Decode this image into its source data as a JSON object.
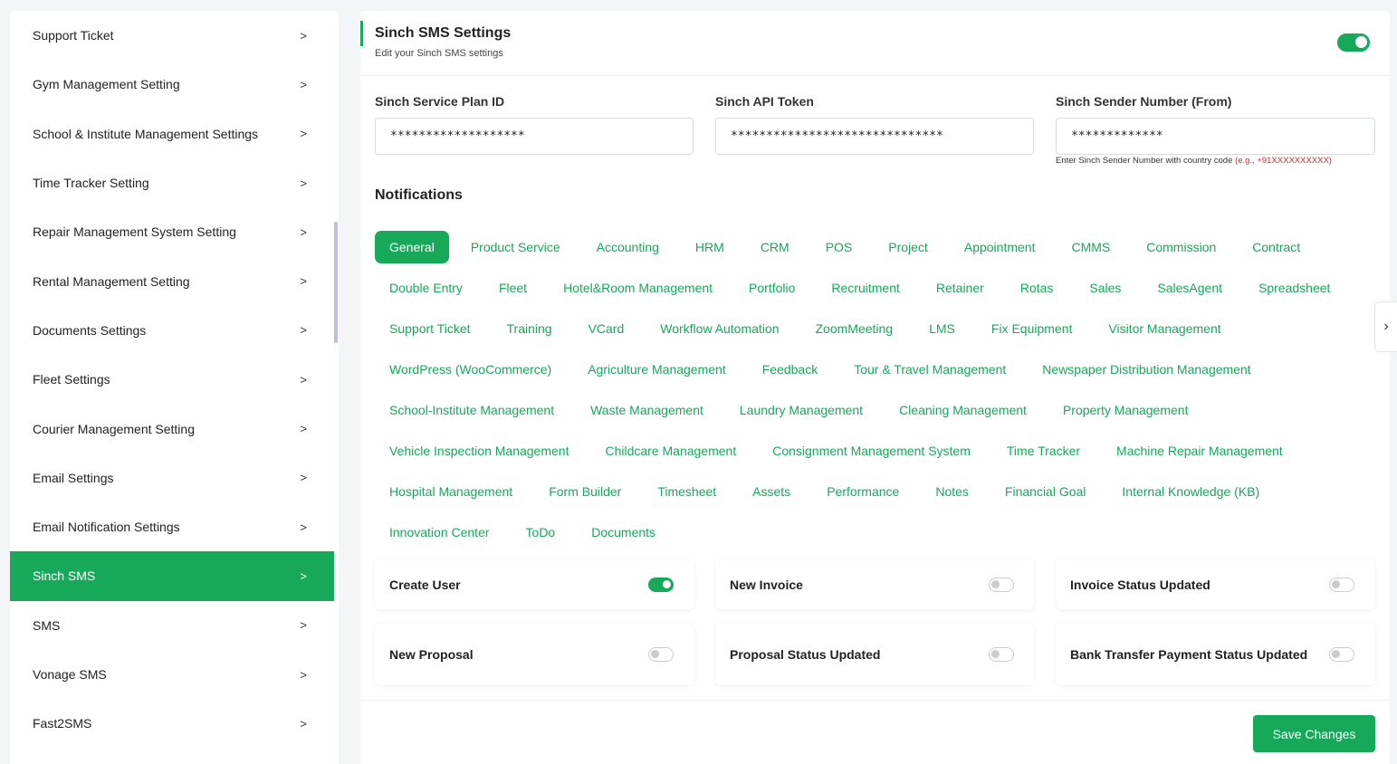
{
  "sidebar": {
    "items": [
      {
        "label": "Support Ticket",
        "active": false
      },
      {
        "label": "Gym Management Setting",
        "active": false
      },
      {
        "label": "School & Institute Management Settings",
        "active": false
      },
      {
        "label": "Time Tracker Setting",
        "active": false
      },
      {
        "label": "Repair Management System Setting",
        "active": false
      },
      {
        "label": "Rental Management Setting",
        "active": false
      },
      {
        "label": "Documents Settings",
        "active": false
      },
      {
        "label": "Fleet Settings",
        "active": false
      },
      {
        "label": "Courier Management Setting",
        "active": false
      },
      {
        "label": "Email Settings",
        "active": false
      },
      {
        "label": "Email Notification Settings",
        "active": false
      },
      {
        "label": "Sinch SMS",
        "active": true
      },
      {
        "label": "SMS",
        "active": false
      },
      {
        "label": "Vonage SMS",
        "active": false
      },
      {
        "label": "Fast2SMS",
        "active": false
      }
    ],
    "chevron": ">"
  },
  "header": {
    "title": "Sinch SMS Settings",
    "subtitle": "Edit your Sinch SMS settings",
    "enabled": true
  },
  "fields": {
    "plan_id": {
      "label": "Sinch Service Plan ID",
      "value": "*******************"
    },
    "api_token": {
      "label": "Sinch API Token",
      "value": "******************************"
    },
    "sender": {
      "label": "Sinch Sender Number (From)",
      "value": "*************"
    },
    "sender_hint": "Enter Sinch Sender Number with country code",
    "sender_hint_example": "(e.g., +91XXXXXXXXXX)"
  },
  "notifications": {
    "title": "Notifications",
    "tab_rows": [
      [
        "General",
        "Product Service",
        "Accounting",
        "HRM",
        "CRM",
        "POS",
        "Project",
        "Appointment",
        "CMMS",
        "Commission",
        "Contract"
      ],
      [
        "Double Entry",
        "Fleet",
        "Hotel&Room Management",
        "Portfolio",
        "Recruitment",
        "Retainer",
        "Rotas",
        "Sales",
        "SalesAgent",
        "Spreadsheet"
      ],
      [
        "Support Ticket",
        "Training",
        "VCard",
        "Workflow Automation",
        "ZoomMeeting",
        "LMS",
        "Fix Equipment",
        "Visitor Management"
      ],
      [
        "WordPress (WooCommerce)",
        "Agriculture Management",
        "Feedback",
        "Tour & Travel Management",
        "Newspaper Distribution Management"
      ],
      [
        "School-Institute Management",
        "Waste Management",
        "Laundry Management",
        "Cleaning Management",
        "Property Management"
      ],
      [
        "Vehicle Inspection Management",
        "Childcare Management",
        "Consignment Management System",
        "Time Tracker",
        "Machine Repair Management"
      ],
      [
        "Hospital Management",
        "Form Builder",
        "Timesheet",
        "Assets",
        "Performance",
        "Notes",
        "Financial Goal",
        "Internal Knowledge (KB)"
      ],
      [
        "Innovation Center",
        "ToDo",
        "Documents"
      ]
    ],
    "active_tab": "General",
    "items": [
      {
        "label": "Create User",
        "enabled": true
      },
      {
        "label": "New Invoice",
        "enabled": false
      },
      {
        "label": "Invoice Status Updated",
        "enabled": false
      },
      {
        "label": "New Proposal",
        "enabled": false
      },
      {
        "label": "Proposal Status Updated",
        "enabled": false
      },
      {
        "label": "Bank Transfer Payment Status Updated",
        "enabled": false
      }
    ]
  },
  "save_label": "Save Changes",
  "side_arrow": "›",
  "colors": {
    "accent": "#17a85a",
    "hint_red": "#e0242b"
  }
}
